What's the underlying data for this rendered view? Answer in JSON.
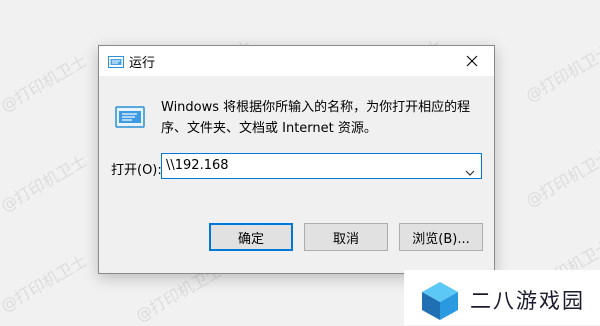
{
  "watermark": "@打印机卫士",
  "dialog": {
    "title": "运行",
    "close_icon": "close-icon",
    "description": "Windows 将根据你所输入的名称，为你打开相应的程序、文件夹、文档或 Internet 资源。",
    "open_label": "打开(O):",
    "open_value": "\\\\192.168",
    "buttons": {
      "ok": "确定",
      "cancel": "取消",
      "browse": "浏览(B)..."
    }
  },
  "brand": {
    "name": "二八游戏园"
  },
  "colors": {
    "accent": "#0078d7",
    "button_bg": "#e1e1e1",
    "dialog_bg": "#f0f0f0"
  }
}
